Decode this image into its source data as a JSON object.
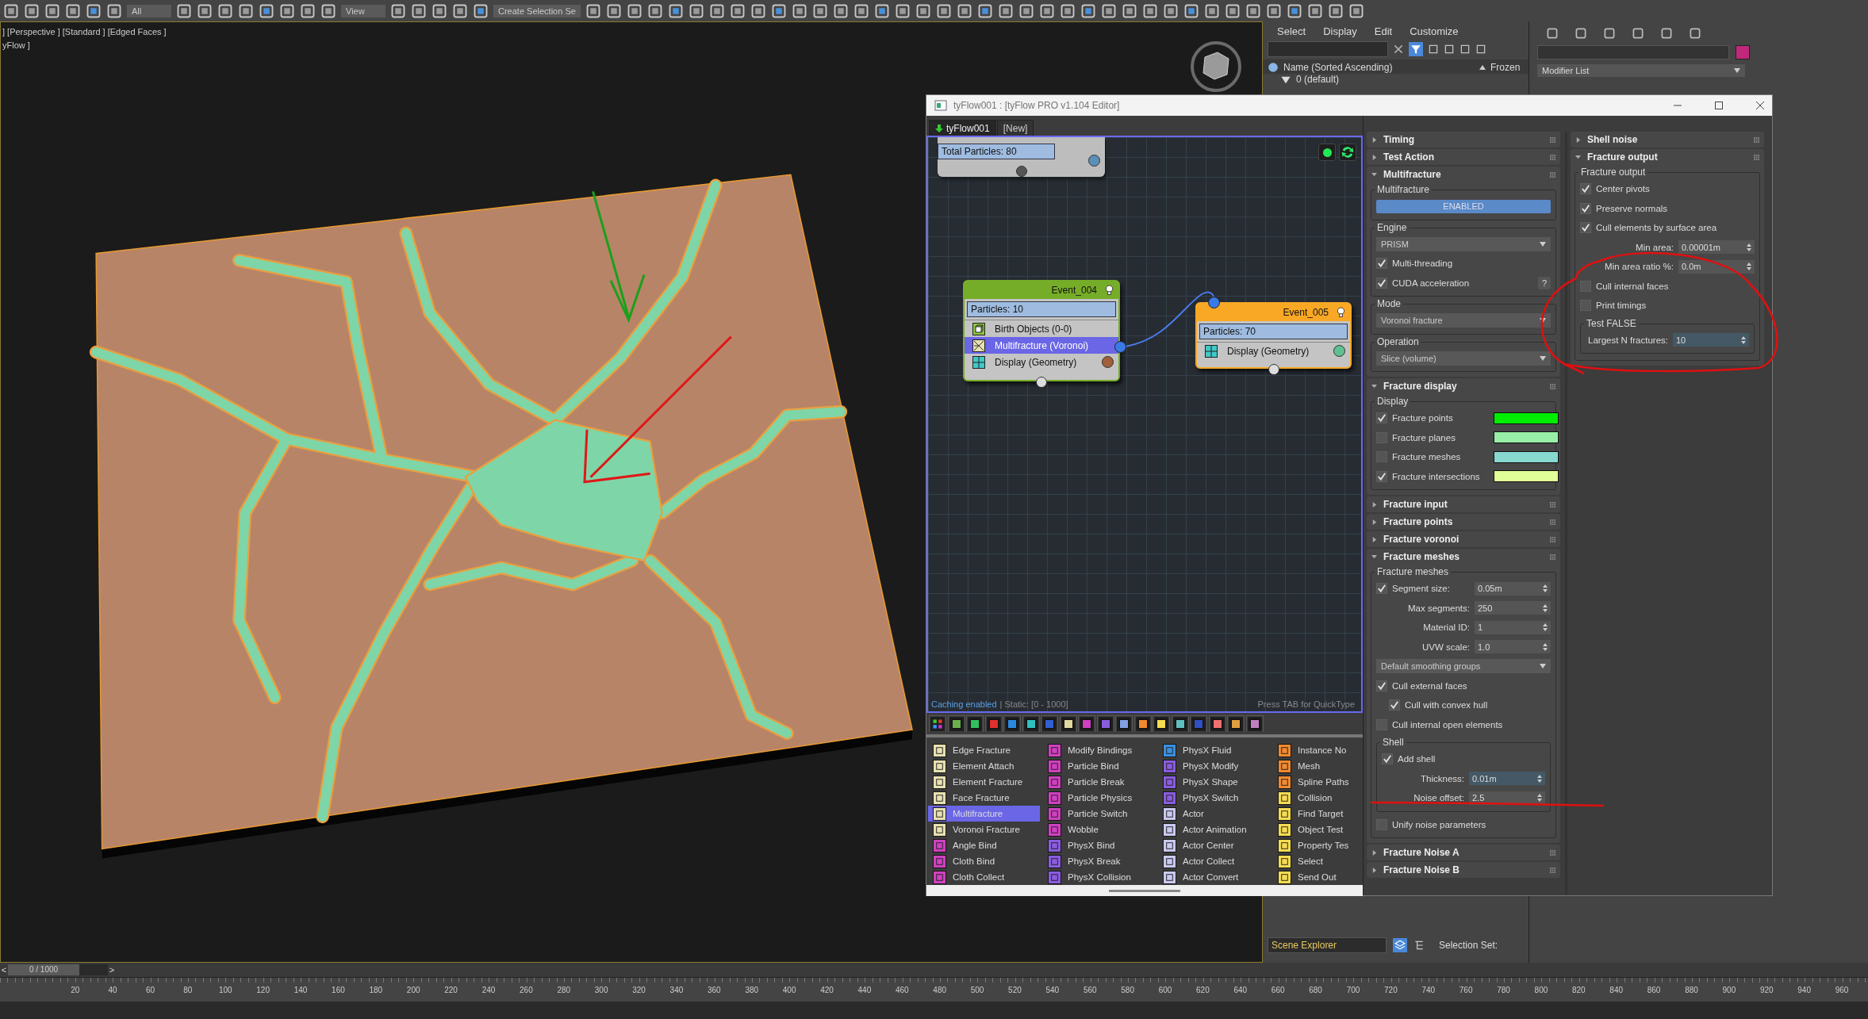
{
  "toolbar": {
    "dropdowns": [
      "All",
      "View",
      "Create Selection Se"
    ]
  },
  "viewport": {
    "labels": [
      "] [Perspective ] [Standard ] [Edged Faces ]",
      "yFlow ]"
    ]
  },
  "scene_explorer": {
    "menu": [
      "Select",
      "Display",
      "Edit",
      "Customize"
    ],
    "columns": [
      "Name (Sorted Ascending)",
      "Frozen"
    ],
    "rows": [
      {
        "name": "0 (default)",
        "expanded": true
      }
    ],
    "footer": {
      "dropdown": "Scene Explorer",
      "label": "Selection Set:"
    }
  },
  "command_panel": {
    "dropdown": "Modifier List"
  },
  "tyflow": {
    "title": "tyFlow001 : [tyFlow PRO v1.104 Editor]",
    "tabs": [
      {
        "label": "tyFlow001",
        "selected": true
      },
      {
        "label": "[New]",
        "selected": false
      }
    ],
    "top_node": {
      "total": "Total Particles: 80"
    },
    "events": [
      {
        "title": "Event_004",
        "color": "#76ad28",
        "particles": "Particles: 10",
        "operators": [
          {
            "label": "Birth Objects (0-0)",
            "kind": "birth",
            "selected": false,
            "linked": false
          },
          {
            "label": "Multifracture (Voronoi)",
            "kind": "fracture",
            "selected": true,
            "linked": true
          },
          {
            "label": "Display (Geometry)",
            "kind": "display",
            "selected": false,
            "linked": false,
            "color": "#a0603a"
          }
        ]
      },
      {
        "title": "Event_005",
        "color": "#f9a825",
        "particles": "Particles: 70",
        "operators": [
          {
            "label": "Display (Geometry)",
            "kind": "display",
            "selected": false,
            "linked": false,
            "color": "#60c090"
          }
        ]
      }
    ],
    "status": {
      "caching": "Caching enabled",
      "static": "| Static: [0 - 1000]",
      "hint": "Press TAB for QuickType"
    },
    "operator_columns": [
      [
        {
          "label": "Edge Fracture",
          "selected": false,
          "color": "#e8e0b0"
        },
        {
          "label": "Element Attach",
          "selected": false,
          "color": "#e8e0b0"
        },
        {
          "label": "Element Fracture",
          "selected": false,
          "color": "#e8e0b0"
        },
        {
          "label": "Face Fracture",
          "selected": false,
          "color": "#e8e0b0"
        },
        {
          "label": "Multifracture",
          "selected": true,
          "color": "#e8e0b0"
        },
        {
          "label": "Voronoi Fracture",
          "selected": false,
          "color": "#e8e0b0"
        },
        {
          "label": "Angle Bind",
          "selected": false,
          "color": "#d040c0"
        },
        {
          "label": "Cloth Bind",
          "selected": false,
          "color": "#d040c0"
        },
        {
          "label": "Cloth Collect",
          "selected": false,
          "color": "#d040c0"
        }
      ],
      [
        {
          "label": "Modify Bindings",
          "selected": false,
          "color": "#d040c0"
        },
        {
          "label": "Particle Bind",
          "selected": false,
          "color": "#d040c0"
        },
        {
          "label": "Particle Break",
          "selected": false,
          "color": "#d040c0"
        },
        {
          "label": "Particle Physics",
          "selected": false,
          "color": "#d040c0"
        },
        {
          "label": "Particle Switch",
          "selected": false,
          "color": "#d040c0"
        },
        {
          "label": "Wobble",
          "selected": false,
          "color": "#d040c0"
        },
        {
          "label": "PhysX Bind",
          "selected": false,
          "color": "#8a5ce0"
        },
        {
          "label": "PhysX Break",
          "selected": false,
          "color": "#8a5ce0"
        },
        {
          "label": "PhysX Collision",
          "selected": false,
          "color": "#8a5ce0"
        }
      ],
      [
        {
          "label": "PhysX Fluid",
          "selected": false,
          "color": "#3a90e0"
        },
        {
          "label": "PhysX Modify",
          "selected": false,
          "color": "#8a5ce0"
        },
        {
          "label": "PhysX Shape",
          "selected": false,
          "color": "#8a5ce0"
        },
        {
          "label": "PhysX Switch",
          "selected": false,
          "color": "#8a5ce0"
        },
        {
          "label": "Actor",
          "selected": false,
          "color": "#c8c8f0"
        },
        {
          "label": "Actor Animation",
          "selected": false,
          "color": "#c8c8f0"
        },
        {
          "label": "Actor Center",
          "selected": false,
          "color": "#c8c8f0"
        },
        {
          "label": "Actor Collect",
          "selected": false,
          "color": "#c8c8f0"
        },
        {
          "label": "Actor Convert",
          "selected": false,
          "color": "#c8c8f0"
        }
      ],
      [
        {
          "label": "Instance No",
          "selected": false,
          "color": "#f08a30"
        },
        {
          "label": "Mesh",
          "selected": false,
          "color": "#f08a30"
        },
        {
          "label": "Spline Paths",
          "selected": false,
          "color": "#f08a30"
        },
        {
          "label": "Collision",
          "selected": false,
          "color": "#f5dc50"
        },
        {
          "label": "Find Target",
          "selected": false,
          "color": "#f5dc50"
        },
        {
          "label": "Object Test",
          "selected": false,
          "color": "#f5dc50"
        },
        {
          "label": "Property Tes",
          "selected": false,
          "color": "#f5dc50"
        },
        {
          "label": "Select",
          "selected": false,
          "color": "#f5dc50"
        },
        {
          "label": "Send Out",
          "selected": false,
          "color": "#f5dc50"
        }
      ]
    ],
    "settings": [
      [
        {
          "title": "Timing",
          "expanded": false
        },
        {
          "title": "Test Action",
          "expanded": false
        },
        {
          "title": "Multifracture",
          "expanded": true,
          "groups": [
            {
              "title": "Multifracture",
              "rows": [
                {
                  "kind": "toggle",
                  "label": "ENABLED"
                }
              ]
            },
            {
              "title": "Engine",
              "rows": [
                {
                  "kind": "dropdown",
                  "value": "PRISM"
                },
                {
                  "kind": "checkbox",
                  "label": "Multi-threading",
                  "checked": true
                },
                {
                  "kind": "checkbox",
                  "label": "CUDA acceleration",
                  "checked": true,
                  "help": "?"
                }
              ]
            },
            {
              "title": "Mode",
              "rows": [
                {
                  "kind": "dropdown",
                  "value": "Voronoi fracture"
                }
              ]
            },
            {
              "title": "Operation",
              "rows": [
                {
                  "kind": "dropdown",
                  "value": "Slice (volume)"
                }
              ]
            }
          ]
        },
        {
          "title": "Fracture display",
          "expanded": true,
          "groups": [
            {
              "title": "Display",
              "rows": [
                {
                  "kind": "swatch",
                  "label": "Fracture points",
                  "checked": true,
                  "color": "#00ee00"
                },
                {
                  "kind": "swatch",
                  "label": "Fracture planes",
                  "checked": false,
                  "color": "#98f0a8"
                },
                {
                  "kind": "swatch",
                  "label": "Fracture meshes",
                  "checked": false,
                  "color": "#88d8d0"
                },
                {
                  "kind": "swatch",
                  "label": "Fracture intersections",
                  "checked": true,
                  "color": "#e0ff98"
                }
              ]
            }
          ]
        },
        {
          "title": "Fracture input",
          "expanded": false
        },
        {
          "title": "Fracture points",
          "expanded": false
        },
        {
          "title": "Fracture voronoi",
          "expanded": false
        },
        {
          "title": "Fracture meshes",
          "expanded": true,
          "groups": [
            {
              "title": "Fracture meshes",
              "rows": [
                {
                  "kind": "checkspinner",
                  "label": "Segment size:",
                  "value": "0.05m",
                  "checked": true,
                  "highlighted": false
                },
                {
                  "kind": "spinner",
                  "label": "Max segments:",
                  "value": "250",
                  "highlighted": false
                },
                {
                  "kind": "spinner",
                  "label": "Material ID:",
                  "value": "1",
                  "highlighted": false
                },
                {
                  "kind": "spinner",
                  "label": "UVW scale:",
                  "value": "1.0",
                  "highlighted": false
                },
                {
                  "kind": "dropdown",
                  "value": "Default smoothing groups"
                },
                {
                  "kind": "checkbox",
                  "label": "Cull external faces",
                  "checked": true,
                  "children": [
                    {
                      "label": "Cull with convex hull",
                      "checked": true
                    }
                  ]
                },
                {
                  "kind": "checkbox",
                  "label": "Cull internal open elements",
                  "checked": false
                },
                {
                  "kind": "group",
                  "title": "Shell",
                  "rows": [
                    {
                      "kind": "checkbox",
                      "label": "Add shell",
                      "checked": true
                    },
                    {
                      "kind": "spinner",
                      "label": "Thickness:",
                      "value": "0.01m",
                      "highlighted": true
                    },
                    {
                      "kind": "spinner",
                      "label": "Noise offset:",
                      "value": "2.5",
                      "highlighted": false
                    }
                  ]
                },
                {
                  "kind": "checkbox",
                  "label": "Unify noise parameters",
                  "checked": false
                }
              ]
            }
          ]
        },
        {
          "title": "Fracture Noise A",
          "expanded": false
        },
        {
          "title": "Fracture Noise B",
          "expanded": false
        }
      ],
      [
        {
          "title": "Shell noise",
          "expanded": false
        },
        {
          "title": "Fracture output",
          "expanded": true,
          "groups": [
            {
              "title": "Fracture output",
              "rows": [
                {
                  "kind": "checkbox",
                  "label": "Center pivots",
                  "checked": true
                },
                {
                  "kind": "checkbox",
                  "label": "Preserve normals",
                  "checked": true
                },
                {
                  "kind": "checkbox",
                  "label": "Cull elements by surface area",
                  "checked": true
                },
                {
                  "kind": "spinner",
                  "label": "Min area:",
                  "value": "0.00001m",
                  "highlighted": false
                },
                {
                  "kind": "spinner",
                  "label": "Min area ratio %:",
                  "value": "0.0m",
                  "highlighted": false
                },
                {
                  "kind": "checkbox",
                  "label": "Cull internal faces",
                  "checked": false
                },
                {
                  "kind": "checkbox",
                  "label": "Print timings",
                  "checked": false
                },
                {
                  "kind": "group",
                  "title": "Test FALSE",
                  "rows": [
                    {
                      "kind": "spinner",
                      "label": "Largest N fractures:",
                      "value": "10",
                      "highlighted": true
                    }
                  ]
                }
              ]
            }
          ]
        }
      ]
    ]
  },
  "timeline": {
    "previous": "<",
    "next": ">",
    "position": "0 / 1000",
    "ticks": [
      "20",
      "40",
      "60",
      "80",
      "100",
      "120",
      "140",
      "160",
      "180",
      "200",
      "220",
      "240",
      "260",
      "280",
      "300",
      "320",
      "340",
      "360",
      "380",
      "400",
      "420",
      "440",
      "460",
      "480",
      "500",
      "520",
      "540",
      "560",
      "580",
      "600",
      "620",
      "640",
      "660",
      "680",
      "700",
      "720",
      "740",
      "760",
      "780",
      "800",
      "820",
      "840",
      "860",
      "880",
      "900",
      "920",
      "940",
      "960"
    ]
  }
}
